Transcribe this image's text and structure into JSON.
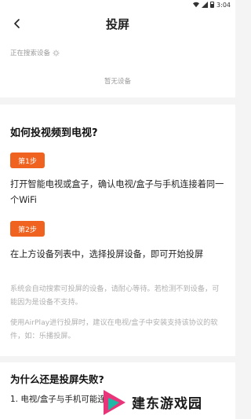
{
  "status_bar": {
    "time": "3:04"
  },
  "header": {
    "title": "投屏"
  },
  "device_panel": {
    "searching_text": "正在搜索设备",
    "empty_text": "暂无设备"
  },
  "help": {
    "heading": "如何投视频到电视?",
    "step1_badge": "第1步",
    "step1_text": "打开智能电视或盒子，确认电视/盒子与手机连接着同一个WiFi",
    "step2_badge": "第2步",
    "step2_text": "在上方设备列表中，选择投屏设备，即可开始投屏",
    "note1": "系统会自动搜索可投屏的设备，请耐心等待。若检测不到设备，可能因为是设备不支持。",
    "note2": "使用AirPlay进行投屏时，建议在电视/盒子中安装支持该协议的软件，如：乐播投屏。",
    "heading2": "为什么还是投屏失败?",
    "fail_item1": "1. 电视/盒子与手机可能连接"
  },
  "watermark": {
    "text": "建东游戏园"
  },
  "colors": {
    "accent": "#f0621f"
  }
}
